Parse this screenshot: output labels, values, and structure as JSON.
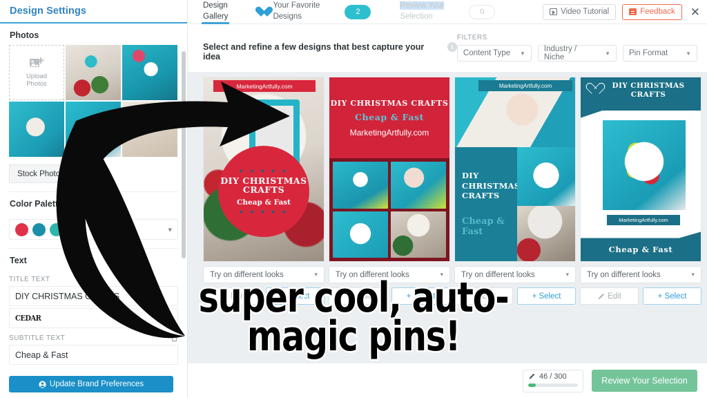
{
  "sidebar": {
    "title": "Design Settings",
    "photos": {
      "heading": "Photos",
      "upload_label_line1": "Upload",
      "upload_label_line2": "Photos",
      "upload_icon": "image-plus-icon",
      "stock_photos_button": "Stock Photos"
    },
    "color_palette": {
      "heading": "Color Palette",
      "swatches": [
        "#e0314a",
        "#1a8fa8",
        "#2fb5ab",
        "#156176"
      ],
      "caret_icon": "chevron-down-icon"
    },
    "text": {
      "heading": "Text",
      "title_label": "TITLE TEXT",
      "title_value": "DIY CHRISTMAS CRAFTS",
      "font_value": "CEDAR",
      "subtitle_label": "SUBTITLE TEXT",
      "subtitle_value": "Cheap & Fast",
      "delete_icon": "trash-icon"
    },
    "brand_button": {
      "label": "Update Brand Preferences",
      "icon": "user-circle-icon"
    }
  },
  "topnav": {
    "tabs": [
      {
        "name": "design-gallery",
        "line1": "Design",
        "line2": "Gallery",
        "active": true
      },
      {
        "name": "favorite-designs",
        "line1": "Your Favorite",
        "line2": "Designs",
        "icon": "heart-icon",
        "badge": "2"
      },
      {
        "name": "review-selection",
        "line1": "Review Your",
        "line2": "Selection",
        "badge": "0",
        "disabled": true
      }
    ],
    "video_tutorial_button": "Video Tutorial",
    "video_tutorial_icon": "play-screen-icon",
    "feedback_button": "Feedback",
    "feedback_icon": "comment-icon",
    "close_icon": "close-icon"
  },
  "main": {
    "prompt": "Select and refine a few designs that best capture your idea",
    "info_icon": "info-icon",
    "filters_label": "FILTERS",
    "filters": [
      {
        "name": "content-type",
        "label": "Content Type"
      },
      {
        "name": "industry-niche",
        "label": "Industry / Niche"
      },
      {
        "name": "pin-format",
        "label": "Pin Format"
      }
    ],
    "cards": [
      {
        "looks_label": "Try on different looks",
        "edit_label": "Edit",
        "select_label": "+ Select",
        "pin": {
          "url": "MarketingArtfully.com",
          "title": "DIY CHRISTMAS CRAFTS",
          "subtitle": "Cheap & Fast",
          "stars": "★ ★ ★ ★ ★"
        }
      },
      {
        "looks_label": "Try on different looks",
        "edit_label": "Edit",
        "select_label": "+ Select",
        "pin": {
          "title": "DIY CHRISTMAS CRAFTS",
          "subtitle": "Cheap & Fast",
          "url": "MarketingArtfully.com"
        }
      },
      {
        "looks_label": "Try on different looks",
        "edit_label": "Edit",
        "select_label": "+ Select",
        "pin": {
          "url": "MarketingArtfully.com",
          "title": "DIY CHRISTMAS CRAFTS",
          "subtitle": "Cheap & Fast"
        }
      },
      {
        "looks_label": "Try on different looks",
        "edit_label": "Edit",
        "select_label": "+ Select",
        "pin": {
          "title": "DIY CHRISTMAS CRAFTS",
          "url": "MarketingArtfully.com",
          "subtitle": "Cheap & Fast",
          "heart_icon": "heart-outline-icon"
        }
      }
    ]
  },
  "footer": {
    "credits_used": "46 / 300",
    "credits_icon": "pencil-icon",
    "credits_percent": 15,
    "review_button": "Review Your Selection"
  },
  "overlay": {
    "caption_line1": "super cool, auto-",
    "caption_line2": "magic pins!",
    "arrow_icon": "curved-arrow-annotation"
  }
}
